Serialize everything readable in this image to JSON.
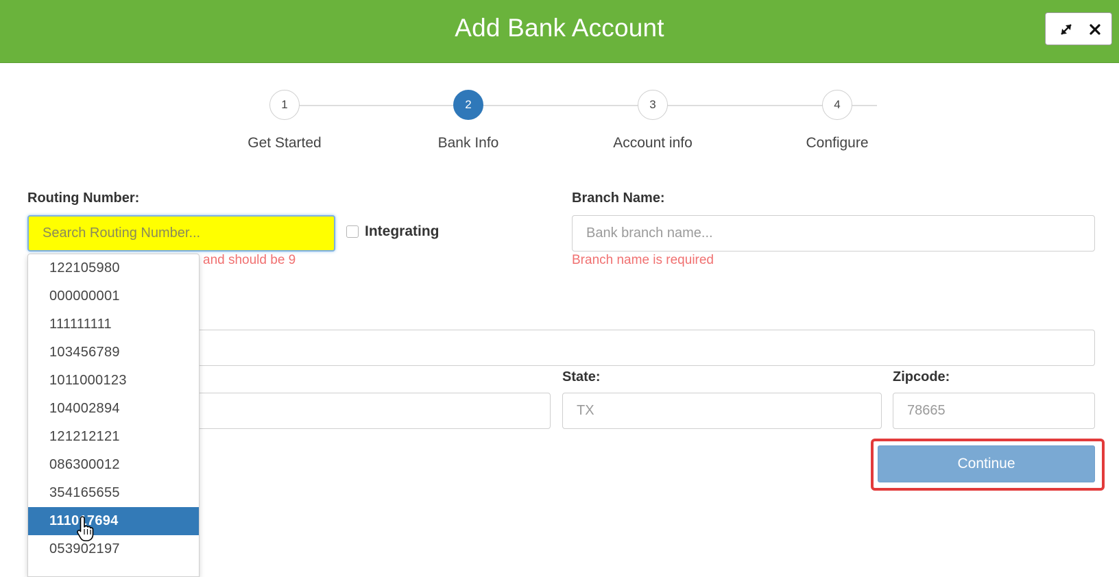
{
  "window": {
    "title": "Add Bank Account",
    "expand_icon": "expand-icon",
    "close_icon": "close-icon"
  },
  "stepper": {
    "steps": [
      {
        "number": "1",
        "label": "Get Started",
        "active": false
      },
      {
        "number": "2",
        "label": "Bank Info",
        "active": true
      },
      {
        "number": "3",
        "label": "Account info",
        "active": false
      },
      {
        "number": "4",
        "label": "Configure",
        "active": false
      }
    ]
  },
  "form": {
    "routing": {
      "label": "Routing Number:",
      "placeholder": "Search Routing Number...",
      "value": "",
      "error_visible": "and should be 9",
      "integrating_label": "Integrating",
      "integrating_checked": false
    },
    "branch": {
      "label": "Branch Name:",
      "placeholder": "Bank branch name...",
      "value": "",
      "error": "Branch name is required"
    },
    "address": {
      "value": ""
    },
    "city": {
      "value": ""
    },
    "state": {
      "label": "State:",
      "placeholder": "TX",
      "value": ""
    },
    "zipcode": {
      "label": "Zipcode:",
      "placeholder": "78665",
      "value": ""
    },
    "continue_label": "Continue"
  },
  "routing_dropdown": {
    "items": [
      "122105980",
      "000000001",
      "111111111",
      "103456789",
      "1011000123",
      "104002894",
      "121212121",
      "086300012",
      "354165655",
      "111017694",
      "053902197"
    ],
    "selected_index": 9
  },
  "colors": {
    "header": "#6ab33c",
    "active_step": "#2f78b9",
    "error": "#f07070",
    "continue": "#7aa9d3",
    "highlight": "#e23b3b",
    "routing_bg": "#ffff00"
  }
}
